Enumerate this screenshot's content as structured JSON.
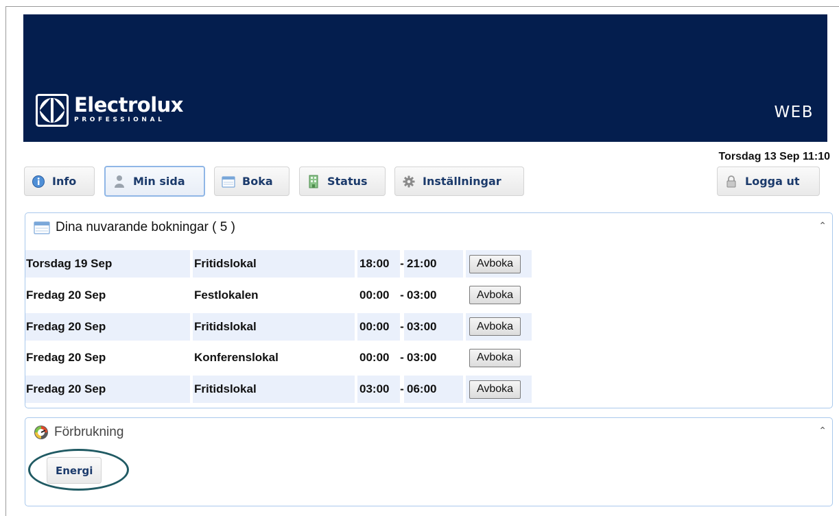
{
  "header": {
    "brand_name": "Electrolux",
    "brand_sub": "PROFESSIONAL",
    "app_label": "WEB",
    "datetime": "Torsdag 13 Sep 11:10"
  },
  "nav": {
    "info": "Info",
    "min_sida": "Min sida",
    "boka": "Boka",
    "status": "Status",
    "installningar": "Inställningar",
    "logga_ut": "Logga ut",
    "active": "min_sida"
  },
  "bookings": {
    "title": "Dina nuvarande bokningar ( 5 )",
    "rows": [
      {
        "date": "Torsdag 19 Sep",
        "place": "Fritidslokal",
        "start": "18:00",
        "dash": "-",
        "end": "21:00",
        "action": "Avboka"
      },
      {
        "date": "Fredag 20 Sep",
        "place": "Festlokalen",
        "start": "00:00",
        "dash": "-",
        "end": "03:00",
        "action": "Avboka"
      },
      {
        "date": "Fredag 20 Sep",
        "place": "Fritidslokal",
        "start": "00:00",
        "dash": "-",
        "end": "03:00",
        "action": "Avboka"
      },
      {
        "date": "Fredag 20 Sep",
        "place": "Konferenslokal",
        "start": "00:00",
        "dash": "-",
        "end": "03:00",
        "action": "Avboka"
      },
      {
        "date": "Fredag 20 Sep",
        "place": "Fritidslokal",
        "start": "03:00",
        "dash": "-",
        "end": "06:00",
        "action": "Avboka"
      }
    ]
  },
  "usage": {
    "title": "Förbrukning",
    "energy_button": "Energi"
  },
  "colors": {
    "banner": "#041e4e",
    "panel_border": "#a9c8ec",
    "row_shade": "#eaf0fb",
    "nav_text": "#1b3a6b",
    "highlight_ring": "#205a63"
  }
}
